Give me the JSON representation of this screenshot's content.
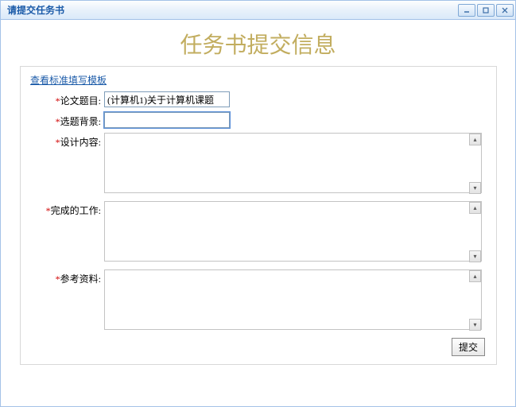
{
  "window": {
    "title": "请提交任务书"
  },
  "header": {
    "page_title": "任务书提交信息",
    "template_link": "查看标准填写模板"
  },
  "fields": {
    "thesis_title": {
      "label": "论文题目:",
      "value": "(计算机1)关于计算机课题"
    },
    "background": {
      "label": "选题背景:",
      "value": ""
    },
    "design": {
      "label": "设计内容:",
      "value": ""
    },
    "work": {
      "label": "完成的工作:",
      "value": ""
    },
    "references": {
      "label": "参考资料:",
      "value": ""
    }
  },
  "buttons": {
    "submit": "提交"
  }
}
